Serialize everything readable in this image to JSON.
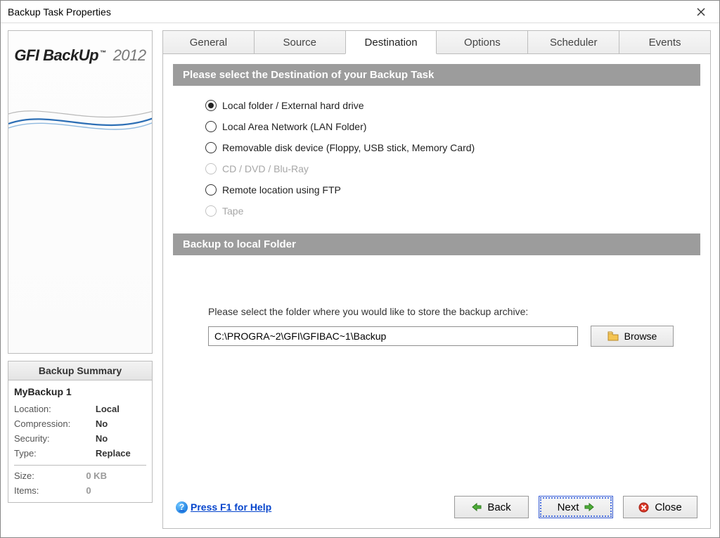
{
  "window": {
    "title": "Backup Task Properties"
  },
  "brand": {
    "name_bold": "GFI",
    "name_rest": "BackUp",
    "year": "2012"
  },
  "tabs": [
    {
      "label": "General"
    },
    {
      "label": "Source"
    },
    {
      "label": "Destination"
    },
    {
      "label": "Options"
    },
    {
      "label": "Scheduler"
    },
    {
      "label": "Events"
    }
  ],
  "section1": {
    "title": "Please select the Destination of your Backup Task"
  },
  "radios": [
    {
      "label": "Local folder / External hard drive",
      "selected": true,
      "disabled": false
    },
    {
      "label": "Local Area Network (LAN Folder)",
      "selected": false,
      "disabled": false
    },
    {
      "label": "Removable disk device (Floppy, USB stick, Memory Card)",
      "selected": false,
      "disabled": false
    },
    {
      "label": "CD / DVD / Blu-Ray",
      "selected": false,
      "disabled": true
    },
    {
      "label": "Remote location using FTP",
      "selected": false,
      "disabled": false
    },
    {
      "label": "Tape",
      "selected": false,
      "disabled": true
    }
  ],
  "section2": {
    "title": "Backup to local Folder"
  },
  "folder": {
    "prompt": "Please select the folder where you would like to store the backup archive:",
    "path": "C:\\PROGRA~2\\GFI\\GFIBAC~1\\Backup",
    "browse": "Browse"
  },
  "summary": {
    "header": "Backup Summary",
    "task_name": "MyBackup 1",
    "rows": [
      {
        "k": "Location:",
        "v": "Local"
      },
      {
        "k": "Compression:",
        "v": "No"
      },
      {
        "k": "Security:",
        "v": "No"
      },
      {
        "k": "Type:",
        "v": "Replace"
      }
    ],
    "rows2": [
      {
        "k": "Size:",
        "v": "0 KB"
      },
      {
        "k": "Items:",
        "v": "0"
      }
    ]
  },
  "footer": {
    "help": "Press F1 for Help",
    "back": "Back",
    "next": "Next",
    "close": "Close"
  }
}
